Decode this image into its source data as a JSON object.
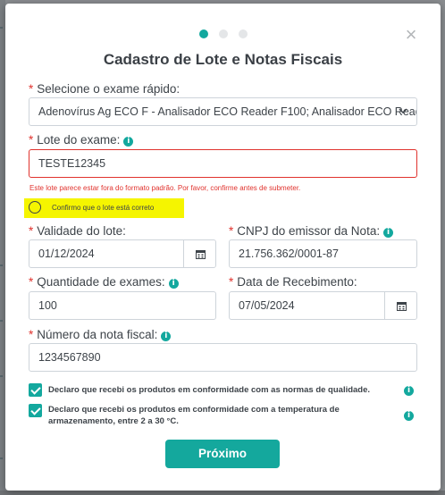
{
  "modal": {
    "title": "Cadastro de Lote e Notas Fiscais",
    "close_glyph": "×",
    "steps": {
      "current": 1,
      "total": 3
    }
  },
  "fields": {
    "exam": {
      "label": "Selecione o exame rápido:",
      "value": "Adenovírus Ag ECO F - Analisador ECO Reader F100; Analisador ECO Reader ..."
    },
    "lot": {
      "label": "Lote do exame:",
      "value": "TESTE12345",
      "error": "Este lote parece estar fora do formato padrão. Por favor, confirme antes de submeter.",
      "confirm_label": "Confirmo que o lote está correto"
    },
    "validity": {
      "label": "Validade do lote:",
      "value": "01/12/2024"
    },
    "cnpj": {
      "label": "CNPJ do emissor da Nota:",
      "value": "21.756.362/0001-87"
    },
    "quantity": {
      "label": "Quantidade de exames:",
      "value": "100"
    },
    "received": {
      "label": "Data de Recebimento:",
      "value": "07/05/2024"
    },
    "invoice": {
      "label": "Número da nota fiscal:",
      "value": "1234567890"
    }
  },
  "declarations": [
    {
      "text": "Declaro que recebi os produtos em conformidade com as normas de qualidade.",
      "checked": true
    },
    {
      "text": "Declaro que recebi os produtos em conformidade com a temperatura de armazenamento, entre 2 a 30 °C.",
      "checked": true
    }
  ],
  "next_label": "Próximo",
  "icons": {
    "info": "info-icon",
    "calendar": "calendar-icon",
    "chevron": "chevron-down-icon",
    "close": "close-icon"
  },
  "colors": {
    "accent": "#13a89e",
    "error": "#e0322d",
    "highlight": "#f5f500"
  }
}
